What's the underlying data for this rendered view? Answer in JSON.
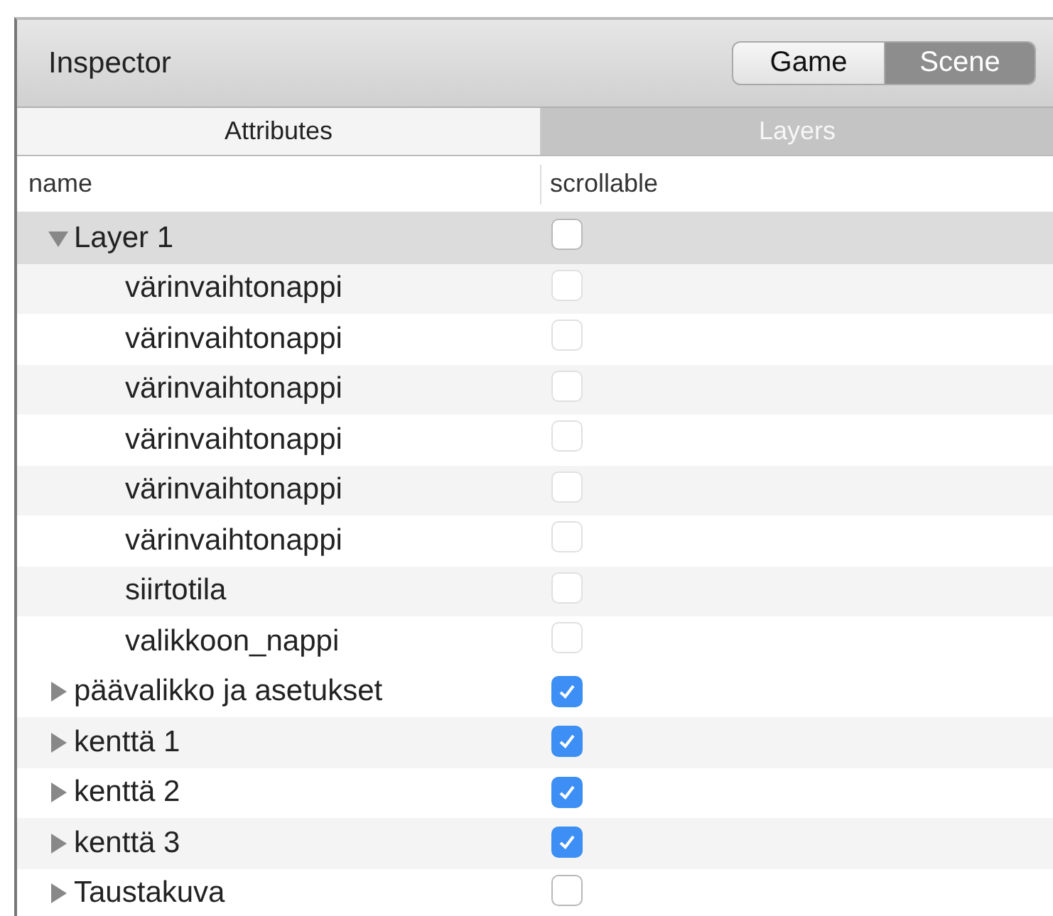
{
  "window": {
    "title": "Inspector"
  },
  "mode_switch": [
    {
      "label": "Game",
      "selected": false
    },
    {
      "label": "Scene",
      "selected": true
    }
  ],
  "tabs": [
    {
      "label": "Attributes",
      "selected": false
    },
    {
      "label": "Layers",
      "selected": true
    }
  ],
  "table": {
    "columns": [
      "name",
      "scrollable"
    ],
    "rows": [
      {
        "name": "Layer 1",
        "scrollable": false,
        "expanded": true,
        "selected": true,
        "children": [
          {
            "name": "värinvaihtonappi",
            "scrollable": false,
            "disabled": true
          },
          {
            "name": "värinvaihtonappi",
            "scrollable": false,
            "disabled": true
          },
          {
            "name": "värinvaihtonappi",
            "scrollable": false,
            "disabled": true
          },
          {
            "name": "värinvaihtonappi",
            "scrollable": false,
            "disabled": true
          },
          {
            "name": "värinvaihtonappi",
            "scrollable": false,
            "disabled": true
          },
          {
            "name": "värinvaihtonappi",
            "scrollable": false,
            "disabled": true
          },
          {
            "name": "siirtotila",
            "scrollable": false,
            "disabled": true
          },
          {
            "name": "valikkoon_nappi",
            "scrollable": false,
            "disabled": true
          }
        ]
      },
      {
        "name": "päävalikko ja asetukset",
        "scrollable": true,
        "expanded": false,
        "selected": false
      },
      {
        "name": "kenttä 1",
        "scrollable": true,
        "expanded": false,
        "selected": false
      },
      {
        "name": "kenttä 2",
        "scrollable": true,
        "expanded": false,
        "selected": false
      },
      {
        "name": "kenttä 3",
        "scrollable": true,
        "expanded": false,
        "selected": false
      },
      {
        "name": "Taustakuva",
        "scrollable": false,
        "expanded": false,
        "selected": false
      }
    ]
  }
}
